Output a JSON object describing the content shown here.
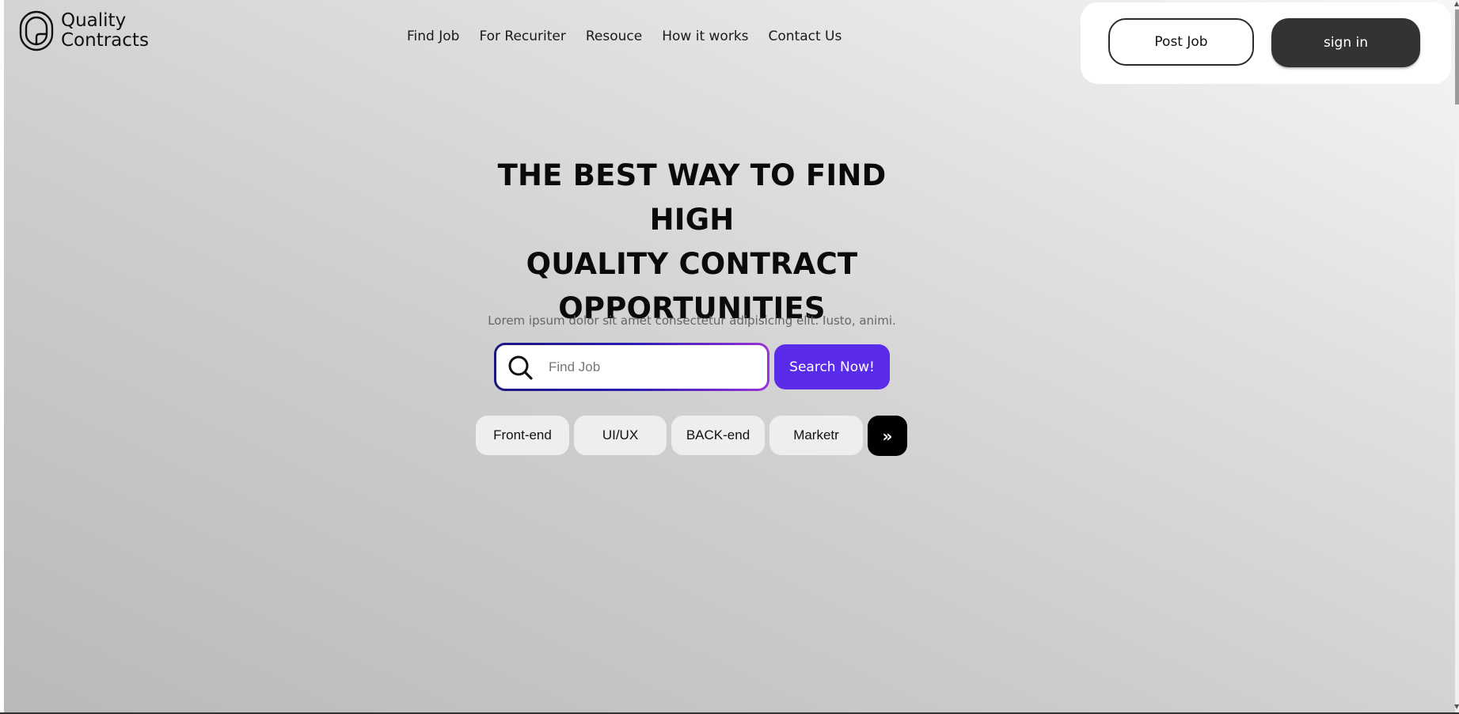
{
  "brand": {
    "name_line1": "Quality",
    "name_line2": "Contracts"
  },
  "nav": {
    "items": [
      {
        "label": "Find Job"
      },
      {
        "label": "For Recuriter"
      },
      {
        "label": "Resouce"
      },
      {
        "label": "How it works"
      },
      {
        "label": "Contact Us"
      }
    ]
  },
  "auth": {
    "post_job_label": "Post Job",
    "sign_in_label": "sign in"
  },
  "hero": {
    "headline_line1": "THE BEST WAY TO FIND HIGH",
    "headline_line2": "QUALITY CONTRACT",
    "headline_line3": "OPPORTUNITIES",
    "subtext": "Lorem ipsum dolor sit amet consectetur adipisicing elit. Iusto, animi."
  },
  "search": {
    "placeholder": "Find Job",
    "value": "",
    "button_label": "Search Now!"
  },
  "categories": [
    {
      "label": "Front-end"
    },
    {
      "label": "UI/UX"
    },
    {
      "label": "BACK-end"
    },
    {
      "label": "Marketr"
    }
  ],
  "more_glyph": "»",
  "colors": {
    "accent": "#5a2be8",
    "dark_button": "#333333",
    "more_button": "#000000"
  }
}
